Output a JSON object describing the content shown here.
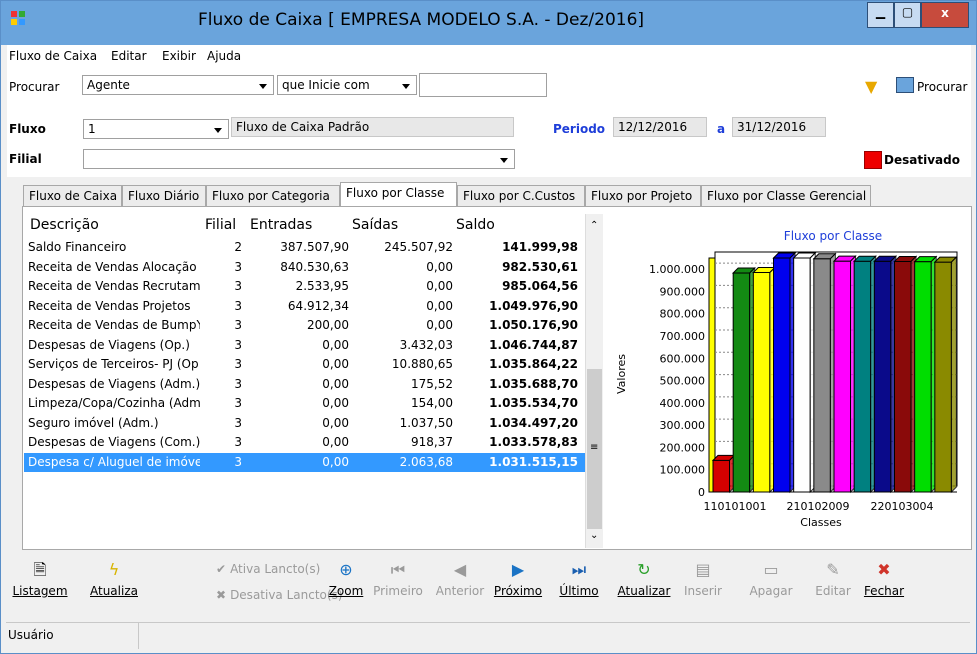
{
  "window": {
    "title": "Fluxo de Caixa [ EMPRESA MODELO S.A. - Dez/2016]",
    "minimize": "▁",
    "maximize": "▢",
    "close": "x"
  },
  "menu": [
    "Fluxo de Caixa",
    "Editar",
    "Exibir",
    "Ajuda"
  ],
  "search": {
    "label": "Procurar",
    "field": "Agente",
    "condition": "que Inicie com",
    "value": "",
    "button": "Procurar"
  },
  "fluxo": {
    "label": "Fluxo",
    "code": "1",
    "name": "Fluxo de Caixa Padrão",
    "periodo_label": "Periodo",
    "start": "12/12/2016",
    "sep": "a",
    "end": "31/12/2016",
    "filial_label": "Filial",
    "filial_value": "",
    "status": "Desativado"
  },
  "tabs": [
    "Fluxo de Caixa",
    "Fluxo Diário",
    "Fluxo por Categoria",
    "Fluxo por Classe",
    "Fluxo por C.Custos",
    "Fluxo por Projeto",
    "Fluxo por Classe Gerencial"
  ],
  "active_tab": "Fluxo por Classe",
  "grid": {
    "headers": [
      "Descrição",
      "Filial",
      "Entradas",
      "Saídas",
      "Saldo"
    ],
    "rows": [
      [
        "Saldo Financeiro",
        "2",
        "387.507,90",
        "245.507,92",
        "141.999,98"
      ],
      [
        "Receita de Vendas Alocação",
        "3",
        "840.530,63",
        "0,00",
        "982.530,61"
      ],
      [
        "Receita de Vendas Recrutame",
        "3",
        "2.533,95",
        "0,00",
        "985.064,56"
      ],
      [
        "Receita de Vendas Projetos",
        "3",
        "64.912,34",
        "0,00",
        "1.049.976,90"
      ],
      [
        "Receita de Vendas de BumpY",
        "3",
        "200,00",
        "0,00",
        "1.050.176,90"
      ],
      [
        "Despesas de Viagens  (Op.)",
        "3",
        "0,00",
        "3.432,03",
        "1.046.744,87"
      ],
      [
        "Serviços de Terceiros- PJ (Op",
        "3",
        "0,00",
        "10.880,65",
        "1.035.864,22"
      ],
      [
        "Despesas de Viagens  (Adm.)",
        "3",
        "0,00",
        "175,52",
        "1.035.688,70"
      ],
      [
        "Limpeza/Copa/Cozinha (Adm.",
        "3",
        "0,00",
        "154,00",
        "1.035.534,70"
      ],
      [
        "Seguro imóvel (Adm.)",
        "3",
        "0,00",
        "1.037,50",
        "1.034.497,20"
      ],
      [
        "Despesas de Viagens  (Com.)",
        "3",
        "0,00",
        "918,37",
        "1.033.578,83"
      ],
      [
        "Despesa c/ Aluguel de imóvei",
        "3",
        "0,00",
        "2.063,68",
        "1.031.515,15"
      ]
    ],
    "selected_row": 11
  },
  "chart_data": {
    "type": "bar",
    "title": "Fluxo por Classe",
    "ylabel": "Valores",
    "xlabel": "Classes",
    "x_tick_labels": [
      "110101001",
      "210102009",
      "220103004"
    ],
    "ylim": [
      0,
      1050000
    ],
    "y_ticks": [
      "0",
      "100.000",
      "200.000",
      "300.000",
      "400.000",
      "500.000",
      "600.000",
      "700.000",
      "800.000",
      "900.000",
      "1.000.000"
    ],
    "values": [
      141999.98,
      982530.61,
      985064.56,
      1049976.9,
      1050176.9,
      1046744.87,
      1035864.22,
      1035688.7,
      1035534.7,
      1034497.2,
      1033578.83,
      1031515.15
    ],
    "colors": [
      "#d40000",
      "#138a13",
      "#ffff00",
      "#0000ee",
      "#ffffff",
      "#8a8a8a",
      "#ff00ff",
      "#008080",
      "#0a0a8a",
      "#8a0a0a",
      "#00dd00",
      "#8a8a00"
    ]
  },
  "toolbar": [
    {
      "label": "Listagem",
      "icon": "report-icon",
      "glyph": "🗎",
      "enabled": true
    },
    {
      "label": "Atualiza",
      "icon": "lightning-icon",
      "glyph": "ϟ",
      "enabled": true
    },
    {
      "label": "Ativa Lancto(s)",
      "icon": "check-icon",
      "glyph": "✔",
      "enabled": false
    },
    {
      "label": "Desativa Lancto(s)",
      "icon": "x-icon",
      "glyph": "✖",
      "enabled": false
    },
    {
      "label": "Zoom",
      "icon": "zoom-icon",
      "glyph": "⊕",
      "enabled": true
    },
    {
      "label": "Primeiro",
      "icon": "first-icon",
      "glyph": "⏮",
      "enabled": false
    },
    {
      "label": "Anterior",
      "icon": "prev-icon",
      "glyph": "◀",
      "enabled": false
    },
    {
      "label": "Próximo",
      "icon": "next-icon",
      "glyph": "▶",
      "enabled": true
    },
    {
      "label": "Último",
      "icon": "last-icon",
      "glyph": "⏭",
      "enabled": true
    },
    {
      "label": "Atualizar",
      "icon": "refresh-icon",
      "glyph": "↻",
      "enabled": true
    },
    {
      "label": "Inserir",
      "icon": "insert-icon",
      "glyph": "▤",
      "enabled": false
    },
    {
      "label": "Apagar",
      "icon": "delete-icon",
      "glyph": "▭",
      "enabled": false
    },
    {
      "label": "Editar",
      "icon": "edit-icon",
      "glyph": "✎",
      "enabled": false
    },
    {
      "label": "Fechar",
      "icon": "close-icon",
      "glyph": "✖",
      "enabled": true
    }
  ],
  "status_bar": {
    "user_label": "Usuário"
  }
}
